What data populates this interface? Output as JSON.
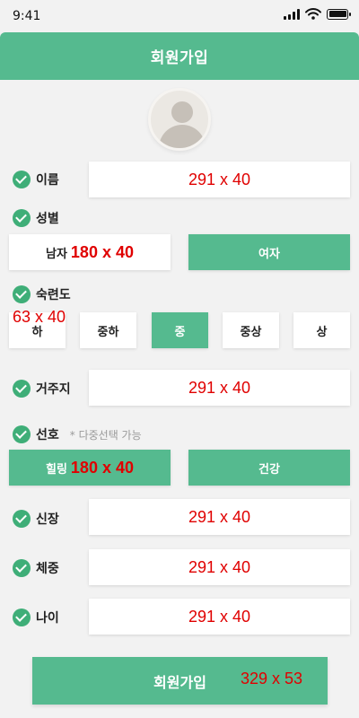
{
  "status": {
    "time": "9:41",
    "icons": [
      "signal-icon",
      "wifi-icon",
      "battery-icon"
    ]
  },
  "header": {
    "title": "회원가입"
  },
  "avatar": {
    "icon": "user-icon"
  },
  "fields": {
    "name": {
      "label": "이름",
      "value": "291 x 40"
    },
    "gender": {
      "label": "성별",
      "options": [
        "남자",
        "여자"
      ],
      "size_note": "180 x 40"
    },
    "skill": {
      "label": "숙련도",
      "options": [
        "하",
        "중하",
        "중",
        "중상",
        "상"
      ],
      "selected": "중",
      "size_note": "63 x 40"
    },
    "address": {
      "label": "거주지",
      "value": "291 x 40"
    },
    "preference": {
      "label": "선호",
      "hint": "* 다중선택 가능",
      "options": [
        "힐링",
        "건강"
      ],
      "size_note": "180 x 40"
    },
    "height": {
      "label": "신장",
      "value": "291 x 40"
    },
    "weight": {
      "label": "체중",
      "value": "291 x 40"
    },
    "age": {
      "label": "나이",
      "value": "291 x 40"
    }
  },
  "submit": {
    "label": "회원가입",
    "size_note": "329 x 53"
  },
  "colors": {
    "accent": "#55ba8f",
    "check": "#3fae78",
    "annotation": "#e00000",
    "background": "#f2f2f2"
  }
}
